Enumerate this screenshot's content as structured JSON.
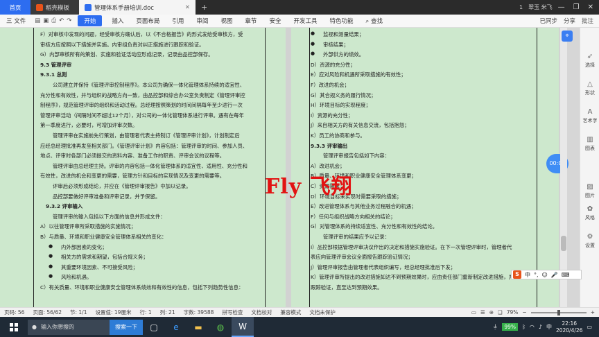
{
  "tabs": {
    "home": "首页",
    "template": "稻壳模板",
    "doc": "管理体系手册培训.doc",
    "plus": "+"
  },
  "window": {
    "count": "1",
    "user": "翠玉 米飞",
    "minimize": "—",
    "restore": "❐",
    "close": "✕"
  },
  "ribbon": {
    "file": "三 文件",
    "start": "开始",
    "items": [
      "插入",
      "页面布局",
      "引用",
      "审阅",
      "视图",
      "章节",
      "安全",
      "开发工具",
      "特色功能"
    ],
    "search": "查找",
    "sync": "已同步",
    "share": "分享",
    "annotate": "批注"
  },
  "left_page": [
    "F）对审核中发现的问题，经受审核方确认后，以《不合格报告》的形式发给受审核方，受",
    "审核方应按照以下措施并实施。内审组负责对纠正措施进行跟踪和验证。",
    "G）内部审核所有的策划、实施和验证活动应形成记录，记录由品控部保存。",
    "9.3 管理评审",
    "9.3.1 总则",
    "公司建立并保持《管理评审控制程序》。本公司为确保一体化管理体系持续的适宜性、",
    "充分性和有效性，并与组织的战略方向一致，由品控部和综合办公室负责制定《管理评审控",
    "制程序》，规范管理评审的组织和活动过程。总经理按照策划的时间间隔每年至少进行一次",
    "管理评审活动（间隔时间不超过12个月），对公司的一体化管理体系进行评审。遇有在每年",
    "第一季度进行，必要时，可增加评审次数。",
    "管理评审在实施前先行策划，由管理者代表主持制订《管理评审计划》，计划制定后",
    "应经总经理批准再发至相关部门。《管理评审计划》内容包括：管理评审的时间、参加人员、",
    "地点、评审时各部门必须提交的资料内容、准备工作的职责、评审会议的议程等。",
    "管理评审由总经理主持。评审的内容包括一体化管理体系的适宜性、适用性、充分性和",
    "有效性，改进的机会和变更的需要，管理方针和目标的实现情况及变更的需要等。",
    "评审后必须形成结论，并应在《管理评审报告》中加以记录。",
    "品控部要做好评审准备和评审记录，并予保留。",
    "9.3.2 评审输入",
    "管理评审的输入包括以下方面的信息并形成文件：",
    "A）以往管理评审所采取措施的实施情况；",
    "B）与质量、环境和职业健康安全管理体系相关的变化：",
    "内外部因素的变化；",
    "相关方的需求和期望，包括合规义务；",
    "其重要环境因素、不可接受风险；",
    "风险和机遇。",
    "C）有关质量、环境和职业健康安全管理体系绩效和有效性的信息，包括下列趋势性信息："
  ],
  "right_page": [
    "监视和测量结果；",
    "审核结果；",
    "外部供方的绩效。",
    "D）资源的充分性；",
    "E）应对风险和机遇所采取措施的有效性；",
    "F）改进的机会；",
    "G）其合规义务的履行情况；",
    "H）环境目标的实现程度；",
    "I）资源的充分性；",
    "J）来自相关方的有关信息交流，包括抱怨；",
    "K）员工的协商和参与。",
    "9.3.3 评审输出",
    "管理评审报告包括如下内容：",
    "A）改进机会；",
    "B）质量、环境和职业健康安全管理体系变更；",
    "C）资源需求；",
    "D）环境目标未实现时需要采取的措施；",
    "E）改进管理体系与其他业务过程融合的机遇；",
    "F）任何与组织战略方向相关的结论；",
    "G）对管理体系的持续适宜性、充分性和有效性的结论。",
    "管理评审的结果应予以记录：",
    "I）品控部根据管理评审决议作出的决定和措施实施验证。在下一次管理评审时，管理者代",
    "表应向管理评审会议全面报告跟踪验证情况；",
    "J）管理评审报告由管理者代表组织编写，经总经理批准后下发；",
    "K）管理评审所提出的改进措施如达不到预期效果时，应由责任部门重新制定改进措施，并",
    "跟踪验证，直至达到预期效果。"
  ],
  "watermark": "Fly 飞翔",
  "timer": "00:00",
  "sidebar": [
    "选择",
    "形状",
    "艺术字",
    "图表",
    "图片",
    "风格",
    "设置"
  ],
  "ime": "中",
  "status": {
    "page": "页码: 56",
    "pages": "页面: 56/62",
    "section": "节: 1/1",
    "setting": "设置值: 19厘米",
    "row": "行: 1",
    "col": "列: 21",
    "words": "字数: 39588",
    "spell": "拼写检查",
    "doc_check": "文档校对",
    "compat": "兼容模式",
    "protect": "文档未保护",
    "zoom": "79%"
  },
  "taskbar": {
    "search_text": "输入你想搜的",
    "search_btn": "搜索一下",
    "battery": "99%",
    "ime": "中",
    "time": "22:16",
    "date": "2020/4/26"
  },
  "colors": {
    "page_bg": "#cde8cd",
    "accent": "#2d6df0",
    "watermark": "#e21212"
  }
}
